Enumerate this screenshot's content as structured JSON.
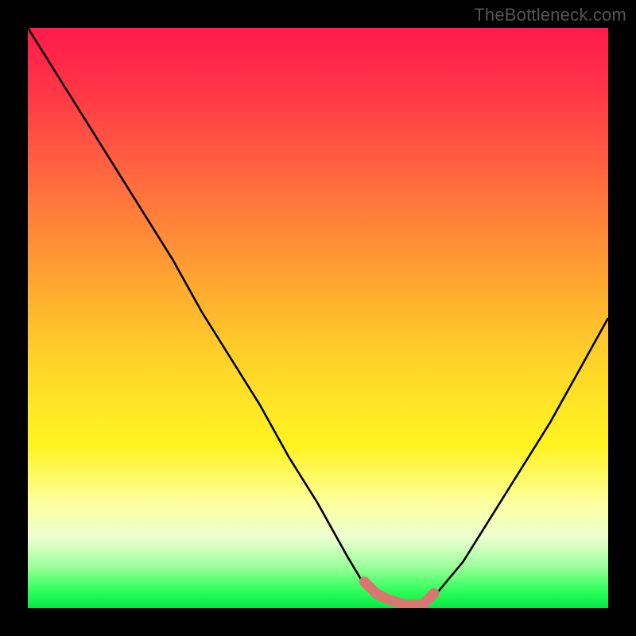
{
  "watermark": "TheBottleneck.com",
  "chart_data": {
    "type": "line",
    "title": "",
    "xlabel": "",
    "ylabel": "",
    "xlim": [
      0,
      100
    ],
    "ylim": [
      0,
      100
    ],
    "x": [
      0,
      5,
      10,
      15,
      20,
      25,
      30,
      35,
      40,
      45,
      50,
      55,
      58,
      60,
      62,
      65,
      68,
      70,
      75,
      80,
      85,
      90,
      95,
      100
    ],
    "values": [
      100,
      92,
      84,
      76,
      68,
      60,
      51,
      43,
      35,
      26,
      18,
      9,
      4,
      2,
      1,
      0,
      0,
      2,
      8,
      16,
      24,
      32,
      41,
      50
    ],
    "annotations": [
      {
        "type": "highlight",
        "x_start": 58,
        "x_end": 70,
        "color": "#d8766f",
        "note": "bottom flat region"
      }
    ],
    "colors": {
      "curve": "#000000",
      "highlight": "#d8766f",
      "gradient_top": "#ff1a4d",
      "gradient_bottom": "#06e845",
      "frame": "#000000"
    }
  }
}
